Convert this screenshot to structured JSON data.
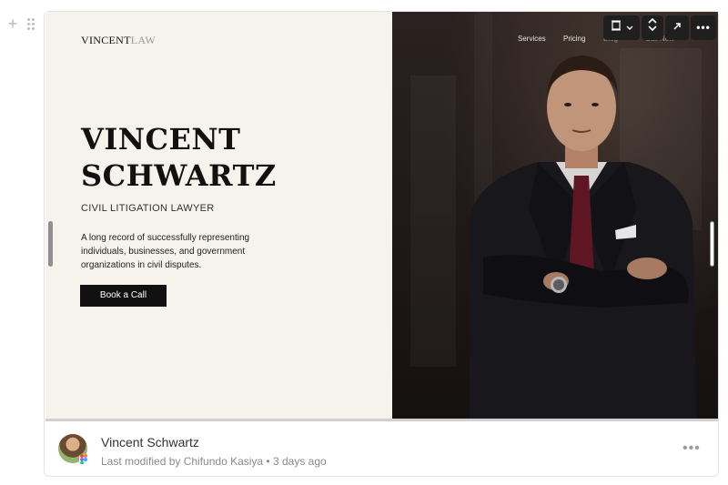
{
  "workspace": {
    "add_icon": "plus-icon",
    "drag_icon": "drag-handle-icon"
  },
  "preview": {
    "logo_bold": "VINCENT",
    "logo_light": "LAW",
    "nav": [
      "Services",
      "Pricing",
      "Blog",
      "Call Now"
    ],
    "hero_line1": "VINCENT",
    "hero_line2": "SCHWARTZ",
    "subtitle": "CIVIL LITIGATION LAWYER",
    "description": "A long record of successfully representing individuals, businesses, and government organizations in civil disputes.",
    "cta_label": "Book a Call",
    "colors": {
      "left_bg": "#f6f2ec",
      "text": "#111111",
      "photo_bg": "#1d1716"
    }
  },
  "toolbar": {
    "icons": [
      "frame-size-icon",
      "chevron-down-icon",
      "expand-vertical-icon",
      "open-external-icon",
      "more-options-icon"
    ]
  },
  "footer": {
    "title": "Vincent Schwartz",
    "meta": "Last modified by Chifundo Kasiya • 3 days ago",
    "more_icon": "more-horizontal-icon"
  }
}
